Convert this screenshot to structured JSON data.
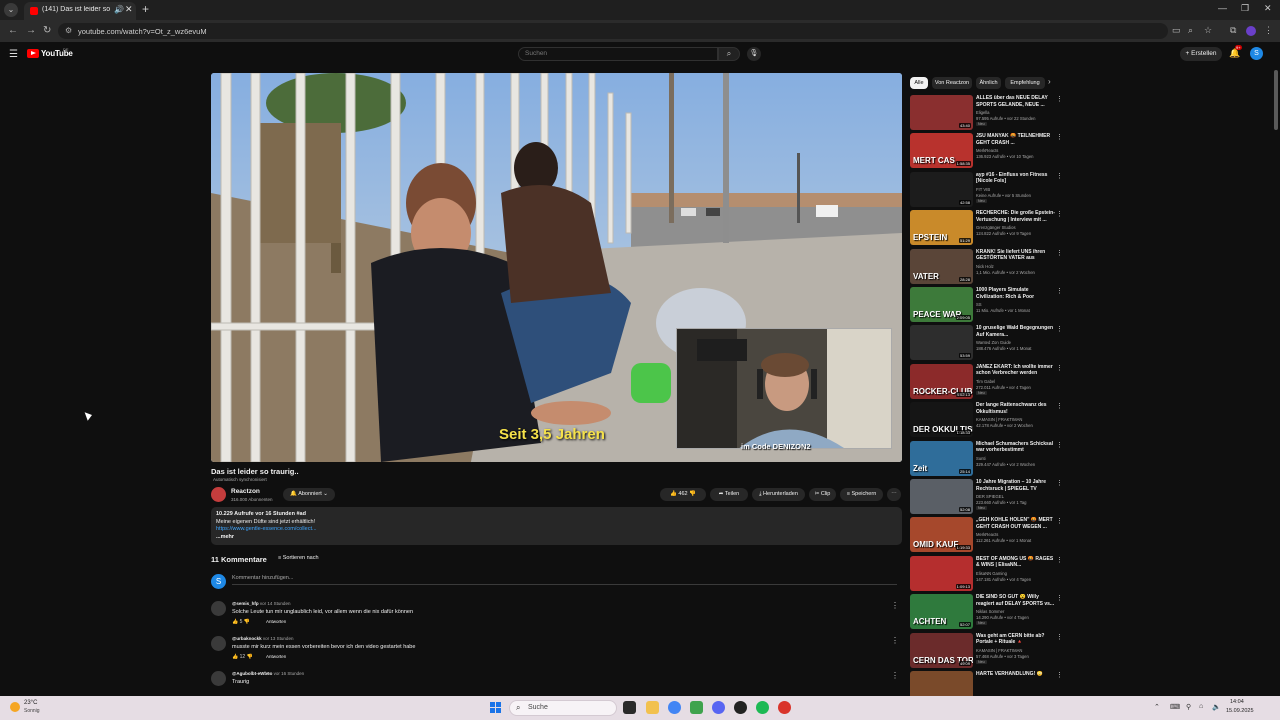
{
  "browser": {
    "tab_title": "(141) Das ist leider so traurig",
    "url": "youtube.com/watch?v=Ot_z_wz6evuM"
  },
  "masthead": {
    "logo": "YouTube",
    "country": "DE",
    "search_placeholder": "Suchen",
    "create_label": "+ Erstellen",
    "notifications": "9+",
    "avatar_letter": "S"
  },
  "player": {
    "subtitle": "Seit 3,5 Jahren",
    "pip_caption": "im Code DENIZON2"
  },
  "video": {
    "title": "Das ist leider so traurig..",
    "auto_translated": "Automatisch synchronisiert",
    "channel": "Reactzon",
    "subscribers": "316.000 Abonnenten",
    "subscribe_label": "Abonniert",
    "likes": "462",
    "share": "Teilen",
    "download": "Herunterladen",
    "clip": "Clip",
    "save": "Speichern"
  },
  "description": {
    "stats": "10.229 Aufrufe  vor 16 Stunden  #ad",
    "line1": "Meine eigenen Düfte sind jetzt erhältlich!",
    "link": "https://www.gentle-essence.com/collect...",
    "more": "...mehr"
  },
  "comments": {
    "count_label": "11 Kommentare",
    "sort_label": "Sortieren nach",
    "add_placeholder": "Kommentar hinzufügen...",
    "reply_label": "Antworten",
    "items": [
      {
        "author": "@semis_hfp",
        "time": "vor 14 Stunden",
        "text": "Solche Leute tun mir unglaublich leid, vor allem wenn die nix dafür können",
        "likes": "5"
      },
      {
        "author": "@urbaknockk",
        "time": "vor 13 Stunden",
        "text": "musste mir kurz mein essen vorbereiten bevor ich den video gestartet habe",
        "likes": "12"
      },
      {
        "author": "@Agubolbt-eWb6o",
        "time": "vor 16 Stunden",
        "text": "Traurig",
        "likes": ""
      }
    ]
  },
  "sidebar": {
    "chips": [
      "Alle",
      "Von Reactzon",
      "Ähnlich",
      "Empfehlung"
    ],
    "recommendations": [
      {
        "title": "ALLES über das NEUE DELAY SPORTS GELANDE, NEUE ...",
        "channel": "Eligella",
        "meta": "97.595 Aufrufe • vor 22 Stunden",
        "duration": "43:40",
        "thumb_text": "",
        "badge": "Neu",
        "color": "#8a2f2f"
      },
      {
        "title": "JSU MANYAK 🤬 TEILNEHMER GEHT CRASH ...",
        "channel": "MerkReacts",
        "meta": "136.923 Aufrufe • vor 10 Tagen",
        "duration": "1:58:35",
        "thumb_text": "MERT CAS",
        "badge": "",
        "color": "#b8322d"
      },
      {
        "title": "ayp #16 - Einfluss von Fitness [Nicole Fois]",
        "channel": "FIT VIB",
        "meta": "Keine Aufrufe • vor 5 Stunden",
        "duration": "42:58",
        "thumb_text": "",
        "badge": "Neu",
        "color": "#1c1c1c"
      },
      {
        "title": "RECHERCHE: Die große Epstein-Vertuschung | Interview mit ...",
        "channel": "Grenzgänger Studios",
        "meta": "124.822 Aufrufe • vor 9 Tagen",
        "duration": "51:29",
        "thumb_text": "EPSTEIN",
        "badge": "",
        "color": "#c98a2a"
      },
      {
        "title": "KRANK! Sie liefert UNS ihren GESTÖRTEN VATER aus",
        "channel": "Nick Holz",
        "meta": "1,1 Mio. Aufrufe • vor 2 Wochen",
        "duration": "28:28",
        "thumb_text": "VATER",
        "badge": "",
        "color": "#5a4538"
      },
      {
        "title": "1000 Players Simulate Civilization: Rich & Poor",
        "channel": "SS",
        "meta": "11 Mio. Aufrufe • vor 1 Monat",
        "duration": "2:09:05",
        "thumb_text": "PEACE WAR",
        "badge": "",
        "color": "#3d7a3a"
      },
      {
        "title": "10 gruselige Wald Begegnungen Auf Kamera...",
        "channel": "Wanted Zon Guide",
        "meta": "188.476 Aufrufe • vor 1 Monat",
        "duration": "53:59",
        "thumb_text": "",
        "badge": "",
        "color": "#2d2d2d"
      },
      {
        "title": "JANEZ EKART: Ich wollte immer schon Verbrecher werden",
        "channel": "Tim Gabel",
        "meta": "272.011 Aufrufe • vor 4 Tagen",
        "duration": "4:02:13",
        "thumb_text": "ROCKER-CLUB",
        "badge": "Neu",
        "color": "#8c2a2a"
      },
      {
        "title": "Der lange Rattenschwanz des Okkultismus!",
        "channel": "KAMASIN | FRAKTIMAN",
        "meta": "42.178 Aufrufe • vor 2 Wochen",
        "duration": "1:18:33",
        "thumb_text": "DER OKKULTISMUS",
        "badge": "",
        "color": "#151515"
      },
      {
        "title": "Michael Schumachers Schicksal war vorherbestimmt",
        "channel": "Sunti",
        "meta": "329.447 Aufrufe • vor 2 Wochen",
        "duration": "25:14",
        "thumb_text": "Zeit",
        "badge": "",
        "color": "#2f6d9a"
      },
      {
        "title": "10 Jahre Migration – 10 Jahre Rechtsruck | SPIEGEL TV",
        "channel": "DER SPIEGEL",
        "meta": "223.660 Aufrufe • vor 1 Tag",
        "duration": "52:08",
        "thumb_text": "",
        "badge": "Neu",
        "color": "#5a5f66"
      },
      {
        "title": "„GEH KOHLE HOLEN\" 🤬 MERT GEHT CRASH OUT WEGEN ...",
        "channel": "MerkReacts",
        "meta": "112.261 Aufrufe • vor 1 Monat",
        "duration": "1:19:33",
        "thumb_text": "OMID KAUF",
        "badge": "",
        "color": "#a6482c"
      },
      {
        "title": "BEST OF AMONG US 🤬 RAGES & WINS | ElisaNN...",
        "channel": "ElisaNN Gaming",
        "meta": "147.181 Aufrufe • vor 4 Tagen",
        "duration": "1:09:13",
        "thumb_text": "",
        "badge": "",
        "color": "#b52e2e"
      },
      {
        "title": "DIE SIND SO GUT 😮 Willy reagiert auf DELAY SPORTS vs...",
        "channel": "Niklas Sommer",
        "meta": "14.290 Aufrufe • vor 4 Tagen",
        "duration": "52:07",
        "thumb_text": "ACHTEN",
        "badge": "Neu",
        "color": "#2f7a3d"
      },
      {
        "title": "Was geht am CERN bitte ab? Portale + Rituale 🔺",
        "channel": "KAMASIN | FRAKTIMAN",
        "meta": "57.468 Aufrufe • vor 3 Tagen",
        "duration": "49:09",
        "thumb_text": "CERN DAS TOR ZUR",
        "badge": "Neu",
        "color": "#6b2b2b"
      },
      {
        "title": "HARTE VERHANDLUNG! 😳",
        "channel": "",
        "meta": "",
        "duration": "",
        "thumb_text": "",
        "badge": "",
        "color": "#7a4a2a"
      }
    ]
  },
  "taskbar": {
    "temp": "23°C",
    "weather": "Sonnig",
    "search": "Suche",
    "time": "14:04",
    "date": "15.09.2025"
  }
}
